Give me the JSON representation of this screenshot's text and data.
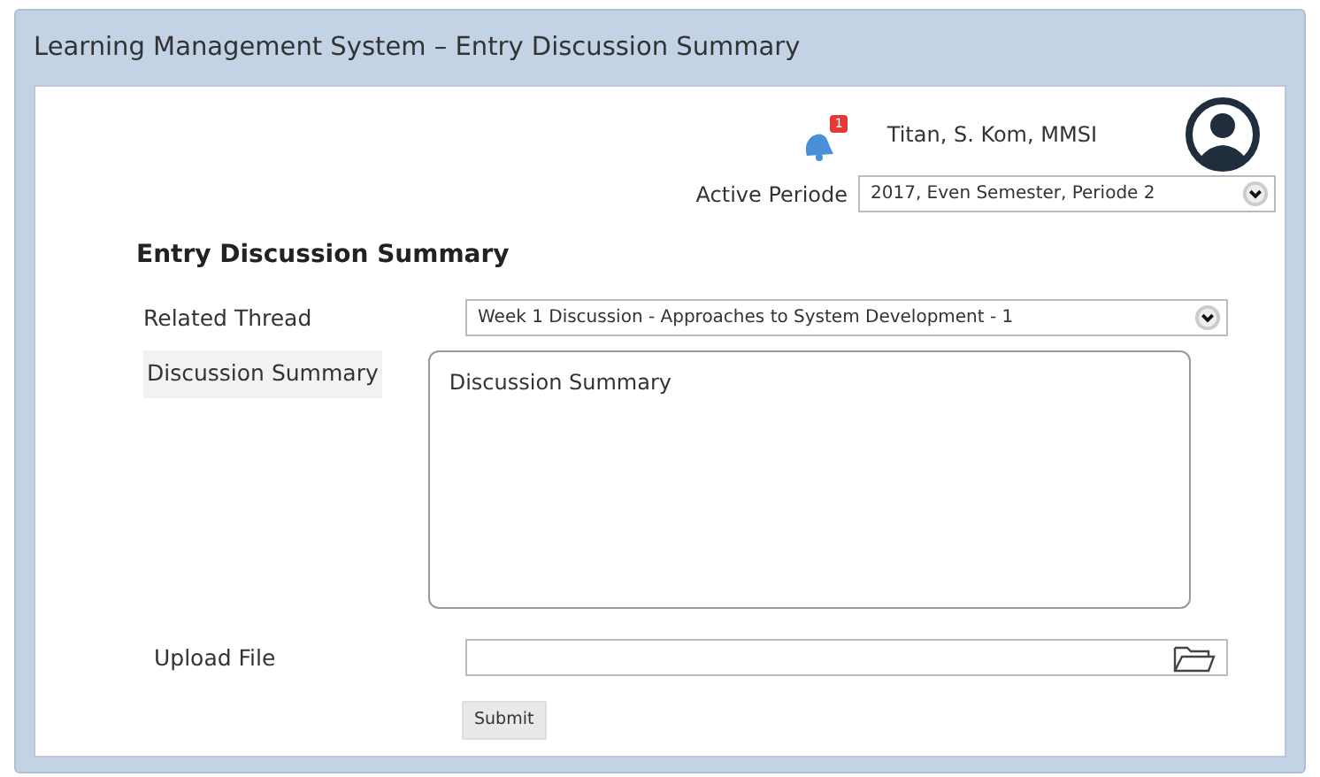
{
  "window": {
    "title": "Learning Management System – Entry Discussion Summary"
  },
  "user": {
    "notification_count": "1",
    "name": "Titan, S. Kom, MMSI"
  },
  "period": {
    "label": "Active Periode",
    "value": "2017, Even Semester, Periode 2"
  },
  "form": {
    "heading": "Entry Discussion Summary",
    "fields": [
      {
        "kind": "select",
        "label": "Related Thread",
        "value": "Week 1 Discussion - Approaches to System Development - 1"
      },
      {
        "kind": "textarea",
        "label": "Discussion Summary",
        "placeholder": "Discussion Summary"
      },
      {
        "kind": "file",
        "label": "Upload File"
      }
    ],
    "submit": "Submit"
  }
}
